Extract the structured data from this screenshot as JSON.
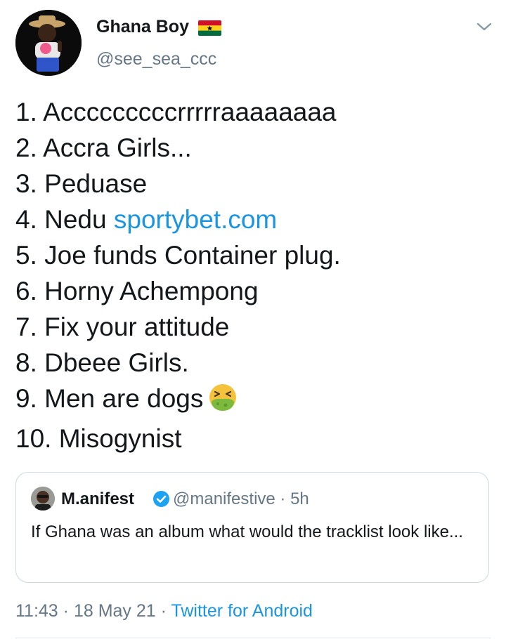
{
  "author": {
    "name": "Ghana Boy",
    "flag_icon": "ghana-flag-emoji",
    "handle": "@see_sea_ccc"
  },
  "tweet": {
    "lines": [
      "1. Acccccccccrrrrraaaaaaaa",
      "2. Accra Girls...",
      "3. Peduase",
      "4. Nedu",
      "5. Joe funds Container plug.",
      "6. Horny Achempong",
      "7. Fix your attitude",
      "8. Dbeee Girls.",
      "9. Men are dogs",
      "10. Misogynist"
    ],
    "link_text": "sportybet.com",
    "emoji": "nauseated-face-emoji"
  },
  "quoted": {
    "name": "M.anifest",
    "handle": "@manifestive",
    "time": "· 5h",
    "text": "If Ghana was an album what would the tracklist look like..."
  },
  "meta": {
    "time": "11:43",
    "sep1": "·",
    "date": "18 May 21",
    "sep2": "·",
    "source": "Twitter for Android"
  },
  "colors": {
    "link": "#1b95e0",
    "secondary_text": "#657786",
    "border": "#cfd9de"
  }
}
